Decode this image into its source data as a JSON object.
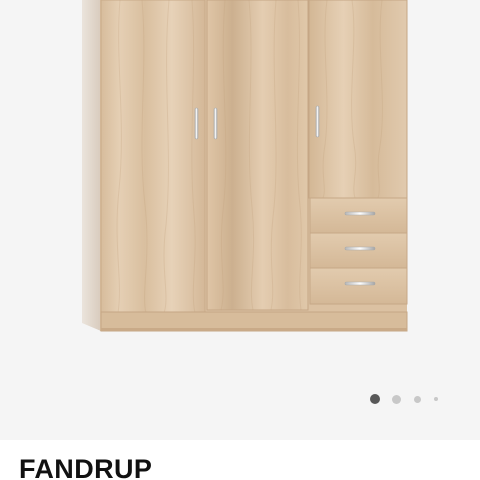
{
  "product": {
    "title": "FANDRUP",
    "image_icon": "wardrobe-product-photo"
  },
  "gallery": {
    "total_images": 4,
    "active_index": 1,
    "active_dot_color": "#585858",
    "inactive_dot_color": "#c8c8c8",
    "background_color": "#f5f5f5"
  },
  "colors": {
    "wood_light": "#e2cbb0",
    "wood_dark": "#c7a987",
    "handle": "#d9d9d9",
    "title_text": "#111111"
  }
}
